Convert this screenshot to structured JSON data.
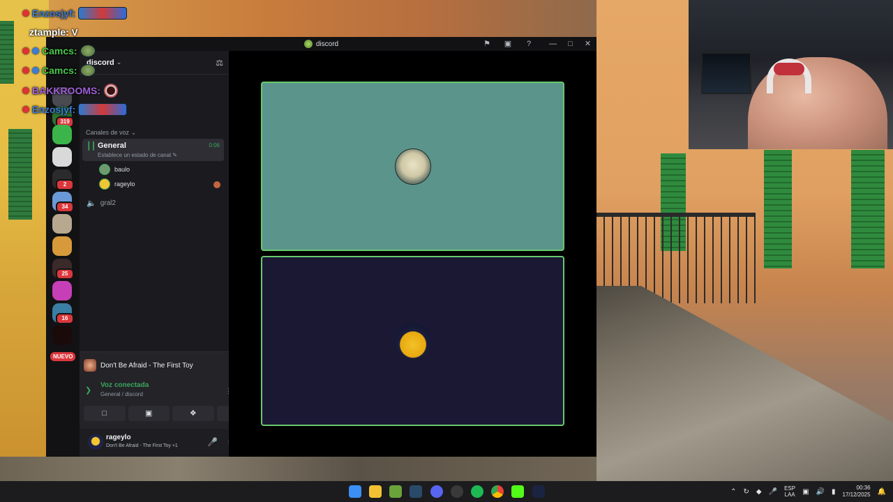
{
  "chat": [
    {
      "name": "Enzosjyf:",
      "color": "#3a7bd5",
      "message": "",
      "emote": "wide"
    },
    {
      "name": "ztample:",
      "color": "#ffffff",
      "message": "V",
      "emote": ""
    },
    {
      "name": "Camcs:",
      "color": "#47c84a",
      "message": "",
      "emote": "small"
    },
    {
      "name": "Camcs:",
      "color": "#47c84a",
      "message": "",
      "emote": "small"
    },
    {
      "name": "BAKKROOMS:",
      "color": "#a060d8",
      "message": "",
      "emote": "ring"
    },
    {
      "name": "Enzosjyf:",
      "color": "#3a7bd5",
      "message": "",
      "emote": "wide"
    }
  ],
  "window": {
    "title": "discord",
    "controls": [
      "⚑",
      "▣",
      "?",
      "—",
      "□",
      "✕"
    ]
  },
  "servers": [
    {
      "badge": "",
      "color": "#8fcf4a"
    },
    {
      "badge": "319",
      "color": "#2f6f2f"
    },
    {
      "badge": "",
      "color": "#3bb54a"
    },
    {
      "badge": "",
      "color": "#d9d9d9"
    },
    {
      "badge": "2",
      "color": "#2b2b2b"
    },
    {
      "badge": "34",
      "color": "#6a9ad6"
    },
    {
      "badge": "",
      "color": "#b8a890"
    },
    {
      "badge": "",
      "color": "#d79a3a"
    },
    {
      "badge": "25",
      "color": "#3a2a2a"
    },
    {
      "badge": "",
      "color": "#c73fb6"
    },
    {
      "badge": "16",
      "color": "#3b7ea3"
    }
  ],
  "nuevo_label": "NUEVO",
  "guild": {
    "name": "discord"
  },
  "voice_category": "Canales de voz",
  "channels": {
    "general": {
      "name": "General",
      "timer": "0:06",
      "status": "Establece un estado de canal",
      "users": [
        {
          "name": "baulo",
          "avatar_color": "#6f9a6f"
        },
        {
          "name": "rageylo",
          "avatar_color": "#f2c532"
        }
      ]
    },
    "gral2": {
      "name": "gral2"
    }
  },
  "now_playing": {
    "title": "Don't Be Afraid - The First Toy"
  },
  "voice": {
    "status": "Voz conectada",
    "location": "General / discord"
  },
  "user": {
    "name": "rageylo",
    "activity": "Don't Be Afraid - The First Toy +1"
  },
  "taskbar": {
    "apps": [
      "start",
      "files",
      "minecraft",
      "steam",
      "discord",
      "obs",
      "spotify",
      "chrome",
      "kick",
      "app"
    ],
    "lang": "ESP",
    "lang2": "LAA",
    "time": "00:36",
    "date": "17/12/2025"
  }
}
